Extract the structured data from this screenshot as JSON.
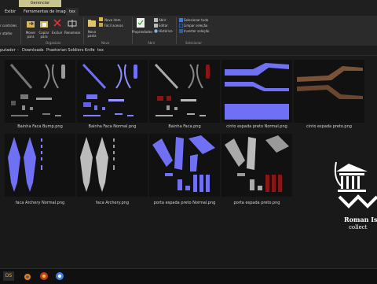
{
  "tabs": {
    "context_header": "Gerenciar",
    "items": [
      "Exibir",
      "Ferramentas de Imagem",
      "tex"
    ]
  },
  "ribbon": {
    "left_labels": [
      "r controles",
      "r atalho"
    ],
    "buttons": {
      "move_to": "Mover para",
      "copy_to": "Copiar para",
      "delete": "Excluir",
      "rename": "Renomear",
      "new_folder": "Nova pasta",
      "new_item": "Novo item",
      "easy_access": "Fácil acesso",
      "properties": "Propriedades",
      "open": "Abrir",
      "edit": "Editar",
      "history": "Histórico",
      "select_all": "Selecionar tudo",
      "select_none": "Limpar seleção",
      "invert_selection": "Inverter seleção"
    },
    "groups": [
      "Organizar",
      "Novo",
      "Abrir",
      "Selecionar"
    ]
  },
  "address": {
    "crumbs": [
      "putador",
      "Downloads",
      "Praetorian Soldiers Knife",
      "tex"
    ]
  },
  "files": [
    {
      "name": "Bainha Faca Bump.png"
    },
    {
      "name": "Bainha Faca Normal.png"
    },
    {
      "name": "Bainha Faca.png"
    },
    {
      "name": "cinto espada preto Normal.png"
    },
    {
      "name": "cinto espada preto.png"
    },
    {
      "name": "faca Archery Normal.png"
    },
    {
      "name": "faca Archery.png"
    },
    {
      "name": "porta espada preto Normal.png"
    },
    {
      "name": "porta espada preto.png"
    }
  ],
  "watermark": {
    "line1": "Roman Is",
    "line2": "collect"
  },
  "colors": {
    "normal_map": "#7070f5",
    "accent_red": "#8a1515",
    "leather": "#7a5236"
  },
  "taskbar": {
    "icons": [
      "ds-icon",
      "blender-icon",
      "app-icon",
      "chrome-icon"
    ],
    "ds_label": "DS"
  }
}
